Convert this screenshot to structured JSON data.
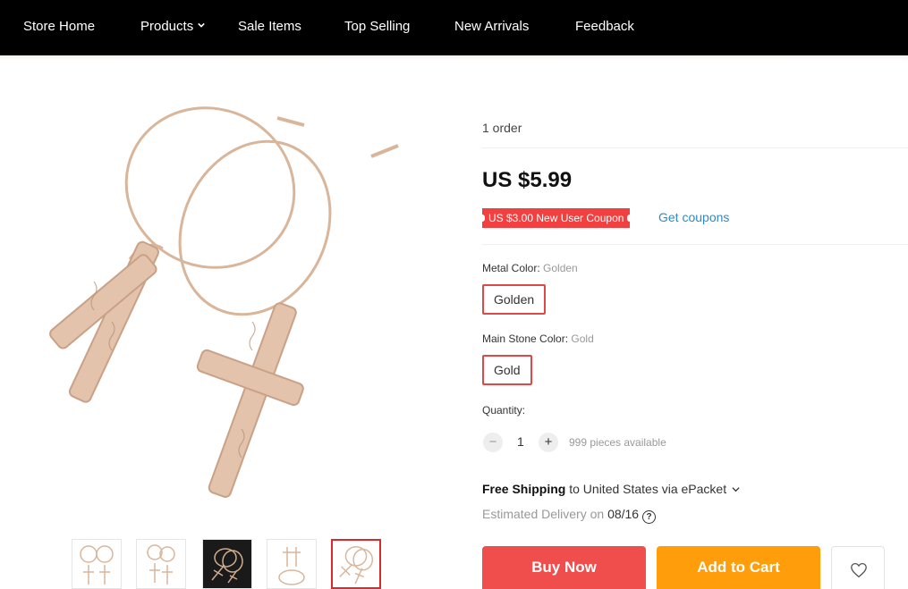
{
  "nav": {
    "items": [
      "Store Home",
      "Products",
      "Sale Items",
      "Top Selling",
      "New Arrivals",
      "Feedback"
    ]
  },
  "product": {
    "orders": "1 order",
    "price": "US $5.99",
    "coupon_text": "US $3.00 New User Coupon",
    "get_coupons": "Get coupons",
    "properties": [
      {
        "label": "Metal Color: ",
        "value": "Golden",
        "selected": "Golden"
      },
      {
        "label": "Main Stone Color: ",
        "value": "Gold",
        "selected": "Gold"
      }
    ],
    "quantity_label": "Quantity:",
    "quantity": "1",
    "minus": "−",
    "plus": "+",
    "available": "999 pieces available",
    "shipping_free": "Free Shipping",
    "shipping_rest": " to United States via ePacket",
    "delivery_label": "Estimated Delivery on ",
    "delivery_date": "08/16",
    "help": "?"
  },
  "actions": {
    "buy_now": "Buy Now",
    "add_to_cart": "Add to Cart"
  },
  "colors": {
    "accent_red": "#f04d4d",
    "accent_orange": "#ff9d0a",
    "link_blue": "#2a8cc7",
    "earring_gold": "#d9b59a"
  },
  "icons": {
    "products_dropdown": "chevron-down-icon",
    "shipping_dropdown": "chevron-down-icon",
    "delivery_help": "question-circle-icon",
    "wishlist": "heart-outline-icon"
  }
}
